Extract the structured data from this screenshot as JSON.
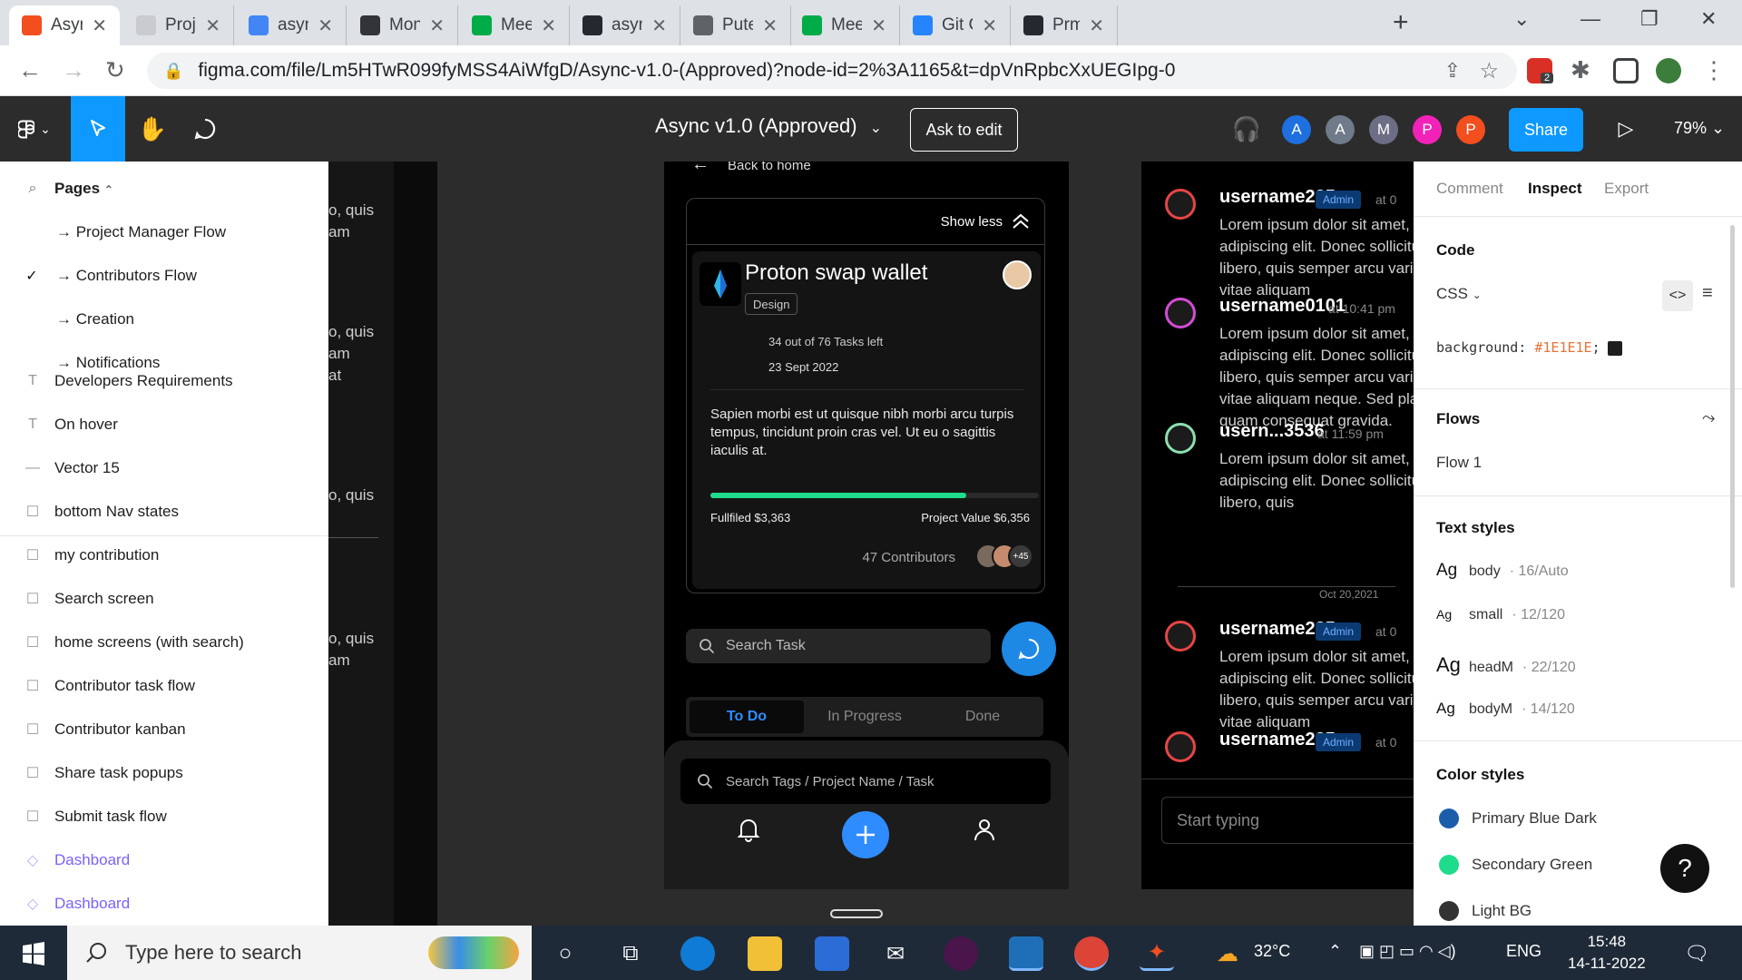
{
  "browser": {
    "tabs": [
      {
        "title": "Async v",
        "active": true,
        "icon": "figma-icon",
        "color": "#f24e1e"
      },
      {
        "title": "Project",
        "icon": "page-icon",
        "color": "#c9cbd1"
      },
      {
        "title": "async d",
        "icon": "docs-icon",
        "color": "#4285f4"
      },
      {
        "title": "Monkey",
        "icon": "monkeytype-icon",
        "color": "#323437"
      },
      {
        "title": "Meet -",
        "icon": "meet-icon",
        "color": "#00ac47"
      },
      {
        "title": "async-",
        "icon": "github-icon",
        "color": "#24292f"
      },
      {
        "title": "Puter",
        "icon": "globe-icon",
        "color": "#5f6368"
      },
      {
        "title": "Meet -",
        "icon": "meet-icon",
        "color": "#00ac47"
      },
      {
        "title": "Git Che",
        "icon": "atlassian-icon",
        "color": "#2684ff"
      },
      {
        "title": "Prmsni",
        "icon": "github-icon",
        "color": "#24292f"
      }
    ],
    "url": "figma.com/file/Lm5HTwR099fyMSS4AiWfgD/Async-v1.0-(Approved)?node-id=2%3A1165&t=dpVnRpbcXxUEGIpg-0",
    "ext_badge": "2"
  },
  "figma": {
    "doc_title": "Async v1.0 (Approved)",
    "ask_to_edit": "Ask to edit",
    "share": "Share",
    "zoom": "79%",
    "avatars": [
      {
        "letter": "A",
        "color": "#1e6fe0"
      },
      {
        "letter": "A",
        "color": "#6f7a8a"
      },
      {
        "letter": "M",
        "color": "#6d6d86"
      },
      {
        "letter": "P",
        "color": "#f222b9"
      },
      {
        "letter": "P",
        "color": "#f24e1e"
      }
    ]
  },
  "layers": {
    "pages_label": "Pages",
    "pages": [
      "→ Project Manager Flow",
      "→ Contributors Flow",
      "→ Creation",
      "→ Notifications"
    ],
    "checked_page": 1,
    "items": [
      {
        "label": "Developers Requirements",
        "icon": "text-icon"
      },
      {
        "label": "On hover",
        "icon": "text-icon"
      },
      {
        "label": "Vector 15",
        "icon": "line-icon"
      },
      {
        "label": "bottom Nav states",
        "icon": "frame-icon"
      },
      {
        "label": "my contribution",
        "icon": "frame-icon"
      },
      {
        "label": "Search screen",
        "icon": "frame-icon"
      },
      {
        "label": "home screens (with search)",
        "icon": "frame-icon"
      },
      {
        "label": "Contributor task flow",
        "icon": "frame-icon"
      },
      {
        "label": "Contributor kanban",
        "icon": "frame-icon"
      },
      {
        "label": "Share task popups",
        "icon": "frame-icon"
      },
      {
        "label": "Submit task flow",
        "icon": "frame-icon"
      },
      {
        "label": "Dashboard",
        "icon": "component-icon",
        "purple": true
      },
      {
        "label": "Dashboard",
        "icon": "component-icon",
        "purple": true
      }
    ]
  },
  "canvas_left": {
    "fragments": [
      "o, quis",
      "am",
      "o, quis",
      "am",
      "at",
      "o, quis",
      "o, quis",
      "am"
    ]
  },
  "phone": {
    "back": "Back to home",
    "show_less": "Show less",
    "project_title": "Proton swap wallet",
    "tag": "Design",
    "tasks_left": "34 out of 76 Tasks left",
    "date": "23 Sept 2022",
    "description": "Sapien morbi est ut quisque nibh morbi arcu turpis tempus,  tincidunt proin cras vel. Ut eu o sagittis iaculis at.",
    "progress": 0.78,
    "fulfilled": "Fullfiled $3,363",
    "project_value": "Project Value $6,356",
    "contributors": "47 Contributors",
    "more_contributors": "+45",
    "search_task": "Search Task",
    "tabs": [
      "To Do",
      "In Progress",
      "Done"
    ],
    "active_tab": 0,
    "search_tags": "Search Tags / Project Name / Task"
  },
  "chat": {
    "messages": [
      {
        "name": "username225",
        "badge": "Admin",
        "time": "at 0",
        "body": "Lorem ipsum dolor sit amet, c adipiscing elit. Donec sollicitu libero, quis semper arcu variu vitae aliquam"
      },
      {
        "name": "username0101",
        "badge": "",
        "time": "at 10:41 pm",
        "body": "Lorem ipsum dolor sit amet, c adipiscing elit. Donec sollicitu libero, quis semper arcu variu vitae aliquam neque. Sed pla quam consequat gravida."
      },
      {
        "name": "usern...3536",
        "badge": "",
        "time": "at 11:59 pm",
        "body": "Lorem ipsum dolor sit amet, c adipiscing elit. Donec sollicitu libero, quis"
      },
      {
        "name": "username225",
        "badge": "Admin",
        "time": "at 0",
        "body": "Lorem ipsum dolor sit amet, c adipiscing elit. Donec sollicitu libero, quis semper arcu variu vitae aliquam"
      },
      {
        "name": "username225",
        "badge": "Admin",
        "time": "at 0",
        "body": ""
      }
    ],
    "date_separator": "Oct 20,2021",
    "input_placeholder": "Start typing"
  },
  "inspect": {
    "tabs": [
      "Comment",
      "Inspect",
      "Export"
    ],
    "active_tab": 1,
    "code_title": "Code",
    "code_lang": "CSS",
    "code_property": "background:",
    "code_value": "#1E1E1E",
    "code_end": ";",
    "flows_title": "Flows",
    "flow": "Flow 1",
    "text_styles_title": "Text styles",
    "text_styles": [
      {
        "ag": "Ag",
        "name": "body",
        "meta": "· 16/Auto"
      },
      {
        "ag": "Ag",
        "name": "small",
        "meta": "· 12/120"
      },
      {
        "ag": "Ag",
        "name": "headM",
        "meta": "· 22/120"
      },
      {
        "ag": "Ag",
        "name": "bodyM",
        "meta": "· 14/120"
      }
    ],
    "color_styles_title": "Color styles",
    "color_styles": [
      {
        "name": "Primary Blue Dark",
        "color": "#1b5dab"
      },
      {
        "name": "Secondary Green",
        "color": "#1edc8b"
      },
      {
        "name": "Light BG",
        "color": "#333333"
      }
    ],
    "help": "?"
  },
  "taskbar": {
    "search_placeholder": "Type here to search",
    "weather": "32°C",
    "lang": "ENG",
    "time": "15:48",
    "date": "14-11-2022"
  }
}
